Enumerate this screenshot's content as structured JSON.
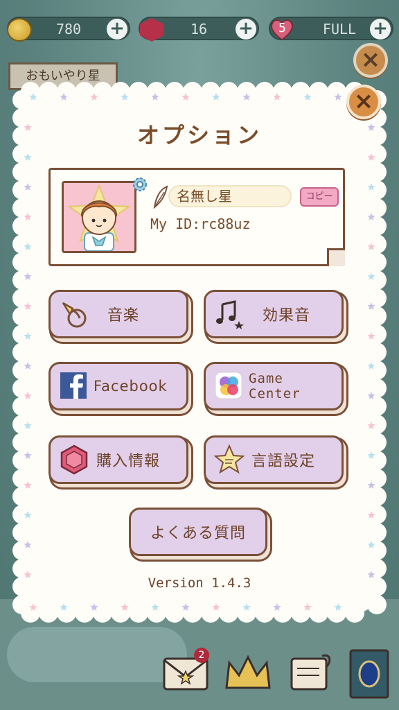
{
  "hud": {
    "coins": "780",
    "gems": "16",
    "lives": "5",
    "life_status": "FULL"
  },
  "background": {
    "sign_text": "おもいやり星"
  },
  "bottom_bar": {
    "mail_badge": "2"
  },
  "modal": {
    "title": "オプション",
    "profile": {
      "name": "名無し星",
      "copy_label": "コピー",
      "my_id": "My ID:rc88uz"
    },
    "buttons": {
      "music": "音楽",
      "sfx": "効果音",
      "facebook": "Facebook",
      "game_center": "Game Center",
      "purchase_info": "購入情報",
      "language": "言語設定",
      "faq": "よくある質問"
    },
    "version": "Version 1.4.3"
  },
  "colors": {
    "button_fill": "#e2cfe9",
    "outline_brown": "#7a5038",
    "text_brown": "#6d4229",
    "close_orange": "#d98e45",
    "copy_pink": "#f3a8c4"
  }
}
